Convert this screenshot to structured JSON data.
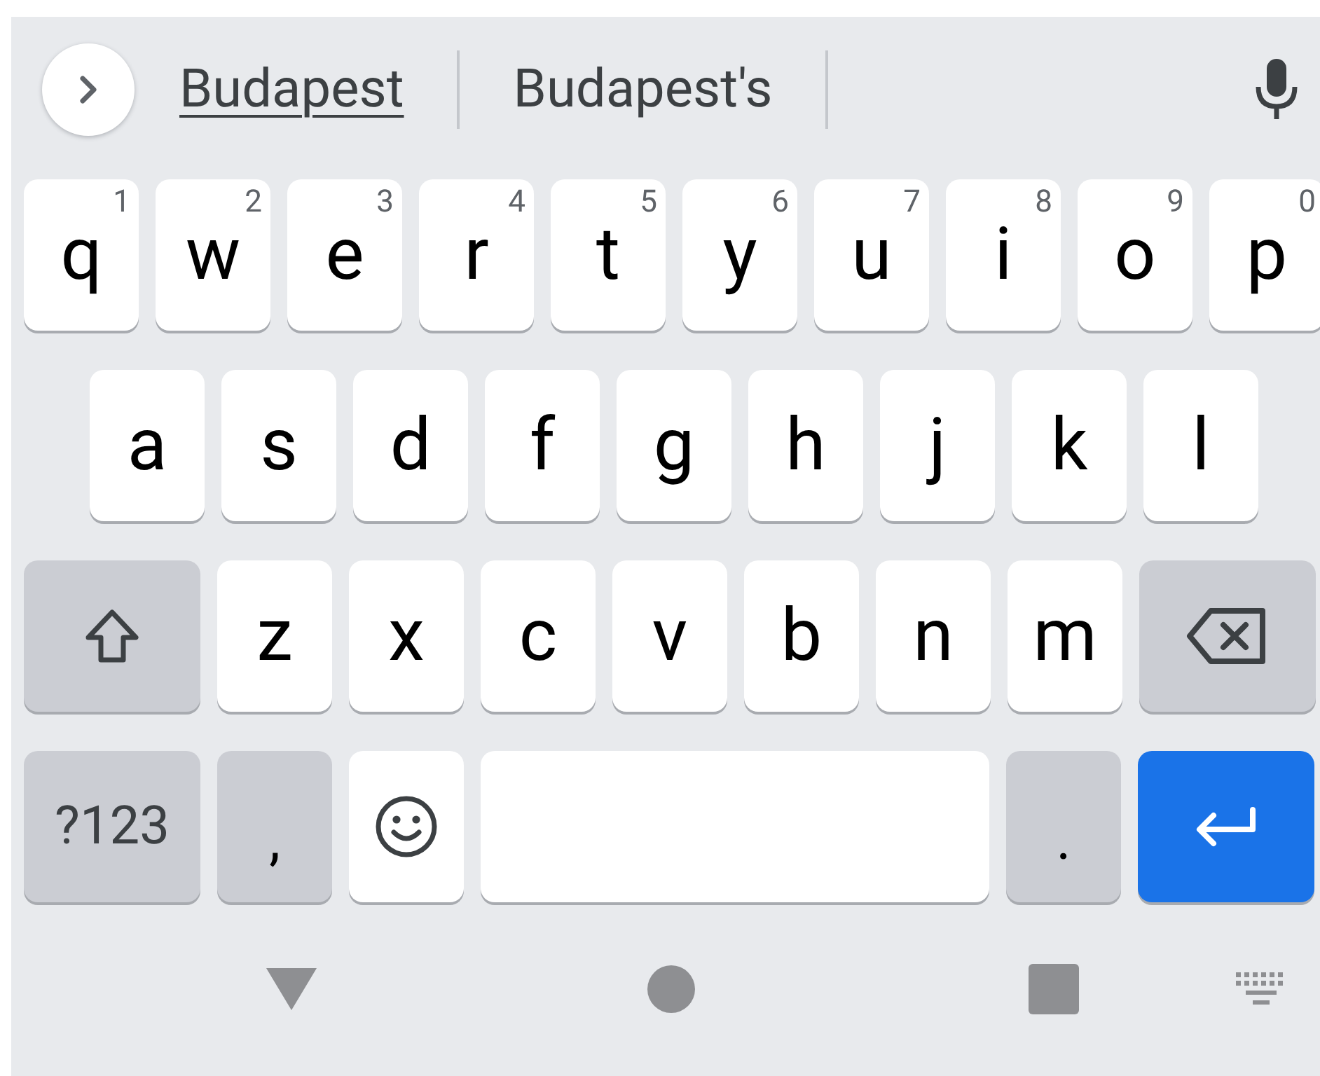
{
  "suggestion_bar": {
    "suggestions": [
      {
        "label": "Budapest",
        "underlined": true
      },
      {
        "label": "Budapest's",
        "underlined": false
      }
    ]
  },
  "rows": [
    {
      "keys": [
        {
          "kind": "letter",
          "label": "q",
          "hint": "1"
        },
        {
          "kind": "letter",
          "label": "w",
          "hint": "2"
        },
        {
          "kind": "letter",
          "label": "e",
          "hint": "3"
        },
        {
          "kind": "letter",
          "label": "r",
          "hint": "4"
        },
        {
          "kind": "letter",
          "label": "t",
          "hint": "5"
        },
        {
          "kind": "letter",
          "label": "y",
          "hint": "6"
        },
        {
          "kind": "letter",
          "label": "u",
          "hint": "7"
        },
        {
          "kind": "letter",
          "label": "i",
          "hint": "8"
        },
        {
          "kind": "letter",
          "label": "o",
          "hint": "9"
        },
        {
          "kind": "letter",
          "label": "p",
          "hint": "0"
        }
      ]
    },
    {
      "keys": [
        {
          "kind": "letter",
          "label": "a"
        },
        {
          "kind": "letter",
          "label": "s"
        },
        {
          "kind": "letter",
          "label": "d"
        },
        {
          "kind": "letter",
          "label": "f"
        },
        {
          "kind": "letter",
          "label": "g"
        },
        {
          "kind": "letter",
          "label": "h"
        },
        {
          "kind": "letter",
          "label": "j"
        },
        {
          "kind": "letter",
          "label": "k"
        },
        {
          "kind": "letter",
          "label": "l"
        }
      ]
    },
    {
      "keys": [
        {
          "kind": "shift"
        },
        {
          "kind": "letter",
          "label": "z"
        },
        {
          "kind": "letter",
          "label": "x"
        },
        {
          "kind": "letter",
          "label": "c"
        },
        {
          "kind": "letter",
          "label": "v"
        },
        {
          "kind": "letter",
          "label": "b"
        },
        {
          "kind": "letter",
          "label": "n"
        },
        {
          "kind": "letter",
          "label": "m"
        },
        {
          "kind": "backspace"
        }
      ]
    },
    {
      "keys": [
        {
          "kind": "symbols",
          "label": "?123"
        },
        {
          "kind": "comma",
          "label": ","
        },
        {
          "kind": "emoji"
        },
        {
          "kind": "space"
        },
        {
          "kind": "period",
          "label": "."
        },
        {
          "kind": "enter"
        }
      ]
    }
  ]
}
